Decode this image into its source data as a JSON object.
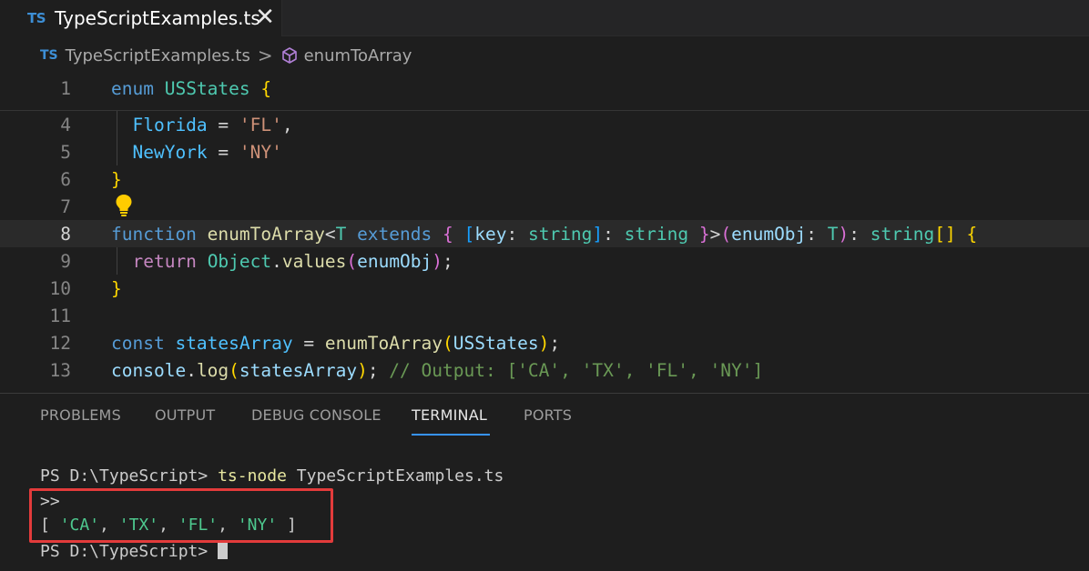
{
  "tab": {
    "icon_text": "TS",
    "label": "TypeScriptExamples.ts",
    "close": "✕"
  },
  "breadcrumb": {
    "icon_text": "TS",
    "file": "TypeScriptExamples.ts",
    "separator": ">",
    "symbol": "enumToArray",
    "symbol_icon": "cube-icon"
  },
  "editor": {
    "line_numbers": [
      "1",
      "4",
      "5",
      "6",
      "7",
      "8",
      "9",
      "10",
      "11",
      "12",
      "13"
    ],
    "active_line": "8",
    "lightbulb_icon": "lightbulb-icon"
  },
  "code": {
    "l1": {
      "kw": "enum",
      "name": "USStates",
      "brace": "{"
    },
    "l4": {
      "key": "Florida",
      "eq": " = ",
      "val": "'FL'",
      "comma": ","
    },
    "l5": {
      "key": "NewYork",
      "eq": " = ",
      "val": "'NY'"
    },
    "l6": {
      "brace": "}"
    },
    "l8": {
      "kw": "function",
      "name": "enumToArray",
      "lt": "<",
      "tparam": "T",
      "extends": "extends",
      "ob": "{",
      "osq": "[",
      "key": "key",
      "colon1": ": ",
      "t1": "string",
      "csq": "]",
      "colon2": ": ",
      "t2": "string",
      "cb": "}",
      "gt": ">",
      "op": "(",
      "param": "enumObj",
      "colon3": ": ",
      "t3": "T",
      "cp": ")",
      "colon4": ": ",
      "t4": "string",
      "arr": "[]",
      "body": "{"
    },
    "l9": {
      "kw": "return",
      "obj": "Object",
      "dot": ".",
      "fn": "values",
      "op": "(",
      "arg": "enumObj",
      "cp": ")",
      "semi": ";"
    },
    "l10": {
      "brace": "}"
    },
    "l12": {
      "kw": "const",
      "name": "statesArray",
      "eq": " = ",
      "fn": "enumToArray",
      "op": "(",
      "arg": "USStates",
      "cp": ")",
      "semi": ";"
    },
    "l13": {
      "obj": "console",
      "dot": ".",
      "fn": "log",
      "op": "(",
      "arg": "statesArray",
      "cp": ")",
      "semi": ";",
      "comment": " // Output: ['CA', 'TX', 'FL', 'NY']"
    }
  },
  "panel": {
    "tabs": [
      "PROBLEMS",
      "OUTPUT",
      "DEBUG CONSOLE",
      "TERMINAL",
      "PORTS"
    ],
    "active_tab": "TERMINAL"
  },
  "terminal": {
    "prompt1": "PS D:\\TypeScript> ",
    "cmd": "ts-node",
    "cmd_arg": " TypeScriptExamples.ts",
    "line2": ">>",
    "out_open": "[ ",
    "out_ca": "'CA'",
    "out_sep1": ", ",
    "out_tx": "'TX'",
    "out_sep2": ", ",
    "out_fl": "'FL'",
    "out_sep3": ", ",
    "out_ny": "'NY'",
    "out_close": " ]",
    "prompt2": "PS D:\\TypeScript> "
  },
  "colors": {
    "highlight_box": "#e33b3b",
    "active_tab_underline": "#3794ff"
  }
}
